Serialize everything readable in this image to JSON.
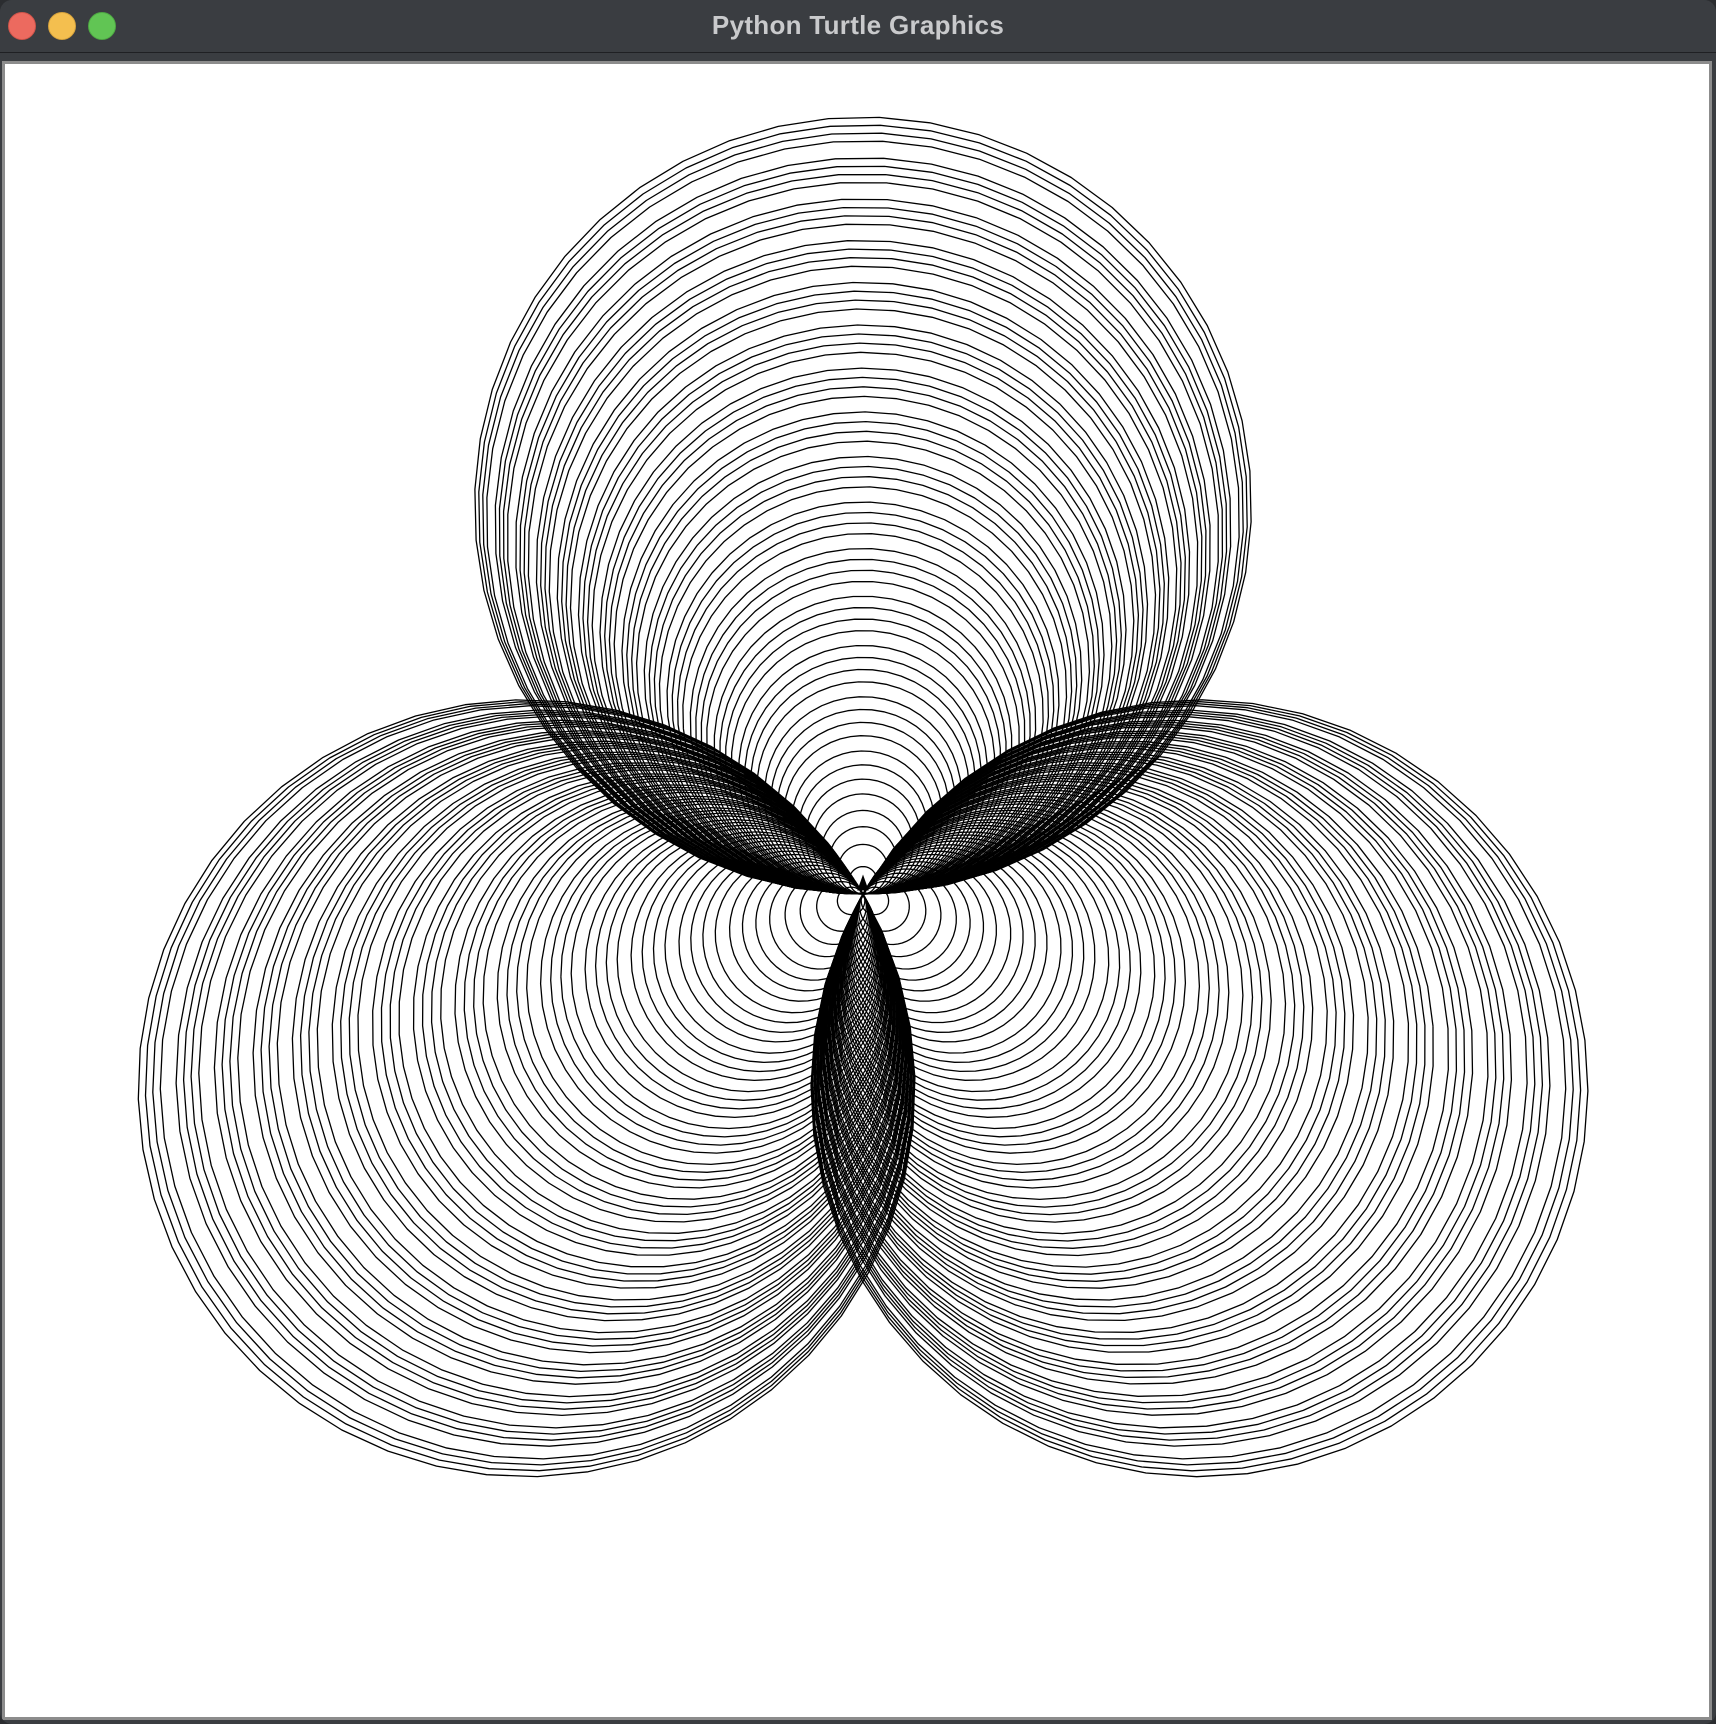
{
  "window": {
    "title": "Python Turtle Graphics"
  },
  "canvas": {
    "background": "#ffffff",
    "pen_color": "#000000"
  },
  "controls": {
    "close_icon": "close-icon",
    "minimize_icon": "minimize-icon",
    "maximize_icon": "maximize-icon"
  }
}
